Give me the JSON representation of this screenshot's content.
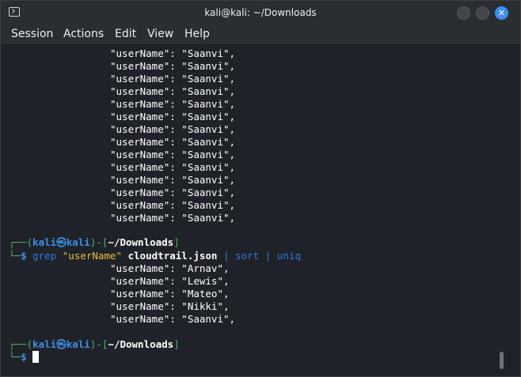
{
  "window": {
    "title": "kali@kali: ~/Downloads",
    "close_glyph": "✕"
  },
  "menu": [
    "Session",
    "Actions",
    "Edit",
    "View",
    "Help"
  ],
  "terminal": {
    "top_output": [
      "\"userName\": \"Saanvi\",",
      "\"userName\": \"Saanvi\",",
      "\"userName\": \"Saanvi\",",
      "\"userName\": \"Saanvi\",",
      "\"userName\": \"Saanvi\",",
      "\"userName\": \"Saanvi\",",
      "\"userName\": \"Saanvi\",",
      "\"userName\": \"Saanvi\",",
      "\"userName\": \"Saanvi\",",
      "\"userName\": \"Saanvi\",",
      "\"userName\": \"Saanvi\",",
      "\"userName\": \"Saanvi\",",
      "\"userName\": \"Saanvi\",",
      "\"userName\": \"Saanvi\","
    ],
    "prompt1": {
      "corner": "┌──(",
      "user": "kali",
      "at": "㉿",
      "host": "kali",
      "mid": ")-[",
      "path": "~/Downloads",
      "end": "]",
      "corner2": "└─",
      "dollar": "$"
    },
    "command": {
      "cmd": "grep",
      "arg": "\"userName\"",
      "file": "cloudtrail.json",
      "pipe1": "|",
      "sort": "sort",
      "pipe2": "|",
      "uniq": "uniq"
    },
    "result_output": [
      "\"userName\": \"Arnav\",",
      "\"userName\": \"Lewis\",",
      "\"userName\": \"Mateo\",",
      "\"userName\": \"Nikki\",",
      "\"userName\": \"Saanvi\","
    ],
    "prompt2": {
      "corner": "┌──(",
      "user": "kali",
      "at": "㉿",
      "host": "kali",
      "mid": ")-[",
      "path": "~/Downloads",
      "end": "]",
      "corner2": "└─",
      "dollar": "$"
    }
  }
}
